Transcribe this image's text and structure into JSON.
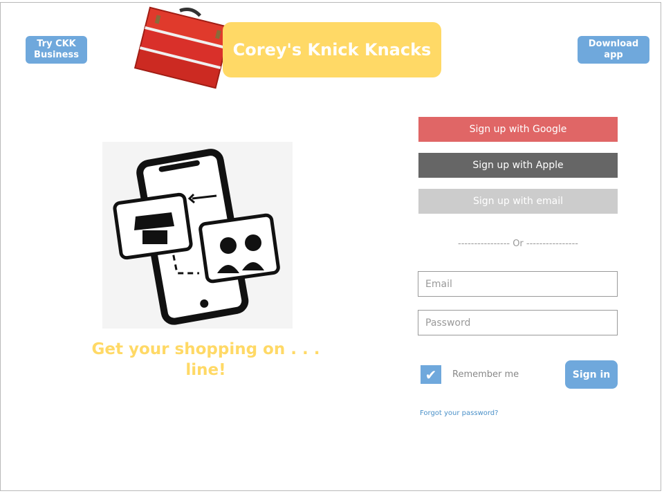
{
  "header": {
    "try_business_label": "Try CKK Business",
    "brand_title": "Corey's Knick Knacks",
    "download_label": "Download app"
  },
  "hero": {
    "tagline": "Get your shopping on . . . line!"
  },
  "signup": {
    "google_label": "Sign up with Google",
    "apple_label": "Sign up with Apple",
    "email_label": "Sign up with email",
    "divider_text": "---------------- Or ----------------"
  },
  "login": {
    "email_placeholder": "Email",
    "password_placeholder": "Password",
    "remember_label": "Remember me",
    "remember_checked": true,
    "signin_label": "Sign in",
    "forgot_label": "Forgot your password?"
  },
  "colors": {
    "accent_blue": "#6fa8dc",
    "brand_yellow": "#ffd966",
    "google_red": "#e06666",
    "apple_gray": "#666666",
    "email_gray": "#cccccc"
  },
  "icons": [
    "toolbox-icon",
    "shopping-phone-illustration",
    "checkmark-icon"
  ]
}
